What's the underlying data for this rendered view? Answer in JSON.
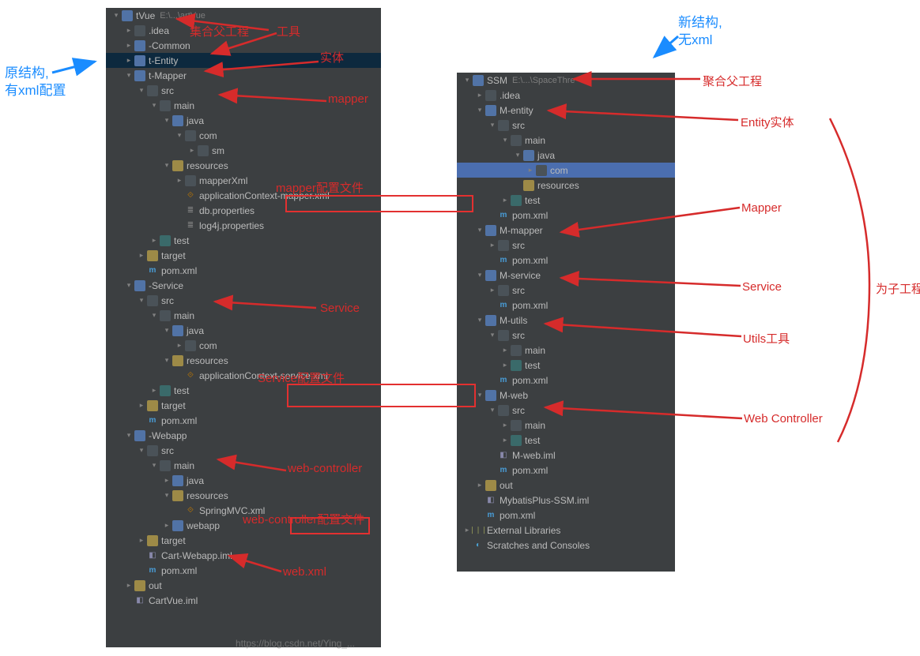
{
  "blue_labels": {
    "left_title": "原结构,\n有xml配置",
    "right_title": "新结构,\n无xml"
  },
  "red_labels": {
    "aggregate_parent": "集合父工程",
    "tool": "工具",
    "entity": "实体",
    "mapper": "mapper",
    "mapper_cfg": "mapper配置文件",
    "service": "Service",
    "service_cfg": "Service配置文件",
    "web_controller": "web-controller",
    "web_controller_cfg": "web-controller配置文件",
    "web_xml": "web.xml",
    "r_aggregate": "聚合父工程",
    "r_entity": "Entity实体",
    "r_mapper": "Mapper",
    "r_service": "Service",
    "r_utils": "Utils工具",
    "r_web": "Web Controller",
    "r_sub": "为子工程"
  },
  "left_tree": [
    {
      "d": 0,
      "a": "expanded",
      "i": "folder-blue",
      "t": "tVue",
      "dim": "E:\\...\\artVue"
    },
    {
      "d": 1,
      "a": "collapsed",
      "i": "folder",
      "t": ".idea"
    },
    {
      "d": 1,
      "a": "collapsed",
      "i": "folder-blue",
      "t": "-Common"
    },
    {
      "d": 1,
      "a": "collapsed",
      "i": "folder-blue",
      "t": "t-Entity",
      "sel": true
    },
    {
      "d": 1,
      "a": "expanded",
      "i": "folder-blue",
      "t": "t-Mapper"
    },
    {
      "d": 2,
      "a": "expanded",
      "i": "folder",
      "t": "src"
    },
    {
      "d": 3,
      "a": "expanded",
      "i": "folder",
      "t": "main"
    },
    {
      "d": 4,
      "a": "expanded",
      "i": "folder-blue",
      "t": "java"
    },
    {
      "d": 5,
      "a": "expanded",
      "i": "folder",
      "t": "com"
    },
    {
      "d": 6,
      "a": "collapsed",
      "i": "folder",
      "t": "sm"
    },
    {
      "d": 4,
      "a": "expanded",
      "i": "folder-gold",
      "t": "resources"
    },
    {
      "d": 5,
      "a": "collapsed",
      "i": "folder",
      "t": "mapperXml"
    },
    {
      "d": 5,
      "a": "",
      "i": "file-xml",
      "t": "applicationContext-mapper.xml"
    },
    {
      "d": 5,
      "a": "",
      "i": "file-prop",
      "t": "db.properties"
    },
    {
      "d": 5,
      "a": "",
      "i": "file-prop",
      "t": "log4j.properties"
    },
    {
      "d": 3,
      "a": "collapsed",
      "i": "folder-teal",
      "t": "test"
    },
    {
      "d": 2,
      "a": "collapsed",
      "i": "folder-gold",
      "t": "target"
    },
    {
      "d": 2,
      "a": "",
      "i": "file-m",
      "t": "pom.xml",
      "m": true
    },
    {
      "d": 1,
      "a": "expanded",
      "i": "folder-blue",
      "t": "-Service"
    },
    {
      "d": 2,
      "a": "expanded",
      "i": "folder",
      "t": "src"
    },
    {
      "d": 3,
      "a": "expanded",
      "i": "folder",
      "t": "main"
    },
    {
      "d": 4,
      "a": "expanded",
      "i": "folder-blue",
      "t": "java"
    },
    {
      "d": 5,
      "a": "collapsed",
      "i": "folder",
      "t": "com"
    },
    {
      "d": 4,
      "a": "expanded",
      "i": "folder-gold",
      "t": "resources"
    },
    {
      "d": 5,
      "a": "",
      "i": "file-xml",
      "t": "applicationContext-service.xml"
    },
    {
      "d": 3,
      "a": "collapsed",
      "i": "folder-teal",
      "t": "test"
    },
    {
      "d": 2,
      "a": "collapsed",
      "i": "folder-gold",
      "t": "target"
    },
    {
      "d": 2,
      "a": "",
      "i": "file-m",
      "t": "pom.xml",
      "m": true
    },
    {
      "d": 1,
      "a": "expanded",
      "i": "folder-blue",
      "t": "-Webapp"
    },
    {
      "d": 2,
      "a": "expanded",
      "i": "folder",
      "t": "src"
    },
    {
      "d": 3,
      "a": "expanded",
      "i": "folder",
      "t": "main"
    },
    {
      "d": 4,
      "a": "collapsed",
      "i": "folder-blue",
      "t": "java"
    },
    {
      "d": 4,
      "a": "expanded",
      "i": "folder-gold",
      "t": "resources"
    },
    {
      "d": 5,
      "a": "",
      "i": "file-xml",
      "t": "SpringMVC.xml"
    },
    {
      "d": 4,
      "a": "collapsed",
      "i": "folder-blue",
      "t": "webapp"
    },
    {
      "d": 2,
      "a": "collapsed",
      "i": "folder-gold",
      "t": "target"
    },
    {
      "d": 2,
      "a": "",
      "i": "file-iml",
      "t": "Cart-Webapp.iml"
    },
    {
      "d": 2,
      "a": "",
      "i": "file-m",
      "t": "pom.xml",
      "m": true
    },
    {
      "d": 1,
      "a": "collapsed",
      "i": "folder-gold",
      "t": "out"
    },
    {
      "d": 1,
      "a": "",
      "i": "file-iml",
      "t": "CartVue.iml"
    }
  ],
  "right_tree": [
    {
      "d": 0,
      "a": "expanded",
      "i": "folder-blue",
      "t": "SSM",
      "dim": "E:\\...\\SpaceThre"
    },
    {
      "d": 1,
      "a": "collapsed",
      "i": "folder",
      "t": ".idea"
    },
    {
      "d": 1,
      "a": "expanded",
      "i": "folder-blue",
      "t": "M-entity"
    },
    {
      "d": 2,
      "a": "expanded",
      "i": "folder",
      "t": "src"
    },
    {
      "d": 3,
      "a": "expanded",
      "i": "folder",
      "t": "main"
    },
    {
      "d": 4,
      "a": "expanded",
      "i": "folder-blue",
      "t": "java"
    },
    {
      "d": 5,
      "a": "collapsed",
      "i": "folder",
      "t": "com",
      "hl": true
    },
    {
      "d": 4,
      "a": "",
      "i": "folder-gold",
      "t": "resources"
    },
    {
      "d": 3,
      "a": "collapsed",
      "i": "folder-teal",
      "t": "test"
    },
    {
      "d": 2,
      "a": "",
      "i": "file-m",
      "t": "pom.xml",
      "m": true
    },
    {
      "d": 1,
      "a": "expanded",
      "i": "folder-blue",
      "t": "M-mapper"
    },
    {
      "d": 2,
      "a": "collapsed",
      "i": "folder",
      "t": "src"
    },
    {
      "d": 2,
      "a": "",
      "i": "file-m",
      "t": "pom.xml",
      "m": true
    },
    {
      "d": 1,
      "a": "expanded",
      "i": "folder-blue",
      "t": "M-service"
    },
    {
      "d": 2,
      "a": "collapsed",
      "i": "folder",
      "t": "src"
    },
    {
      "d": 2,
      "a": "",
      "i": "file-m",
      "t": "pom.xml",
      "m": true
    },
    {
      "d": 1,
      "a": "expanded",
      "i": "folder-blue",
      "t": "M-utils"
    },
    {
      "d": 2,
      "a": "expanded",
      "i": "folder",
      "t": "src"
    },
    {
      "d": 3,
      "a": "collapsed",
      "i": "folder",
      "t": "main"
    },
    {
      "d": 3,
      "a": "collapsed",
      "i": "folder-teal",
      "t": "test"
    },
    {
      "d": 2,
      "a": "",
      "i": "file-m",
      "t": "pom.xml",
      "m": true
    },
    {
      "d": 1,
      "a": "expanded",
      "i": "folder-blue",
      "t": "M-web"
    },
    {
      "d": 2,
      "a": "expanded",
      "i": "folder",
      "t": "src"
    },
    {
      "d": 3,
      "a": "collapsed",
      "i": "folder",
      "t": "main"
    },
    {
      "d": 3,
      "a": "collapsed",
      "i": "folder-teal",
      "t": "test"
    },
    {
      "d": 2,
      "a": "",
      "i": "file-iml",
      "t": "M-web.iml"
    },
    {
      "d": 2,
      "a": "",
      "i": "file-m",
      "t": "pom.xml",
      "m": true
    },
    {
      "d": 1,
      "a": "collapsed",
      "i": "folder-gold",
      "t": "out"
    },
    {
      "d": 1,
      "a": "",
      "i": "file-iml",
      "t": "MybatisPlus-SSM.iml"
    },
    {
      "d": 1,
      "a": "",
      "i": "file-m",
      "t": "pom.xml",
      "m": true
    },
    {
      "d": 0,
      "a": "collapsed",
      "i": "lib",
      "t": "External Libraries"
    },
    {
      "d": 0,
      "a": "",
      "i": "scratch",
      "t": "Scratches and Consoles"
    }
  ],
  "watermark": "https://blog.csdn.net/Ying_..."
}
